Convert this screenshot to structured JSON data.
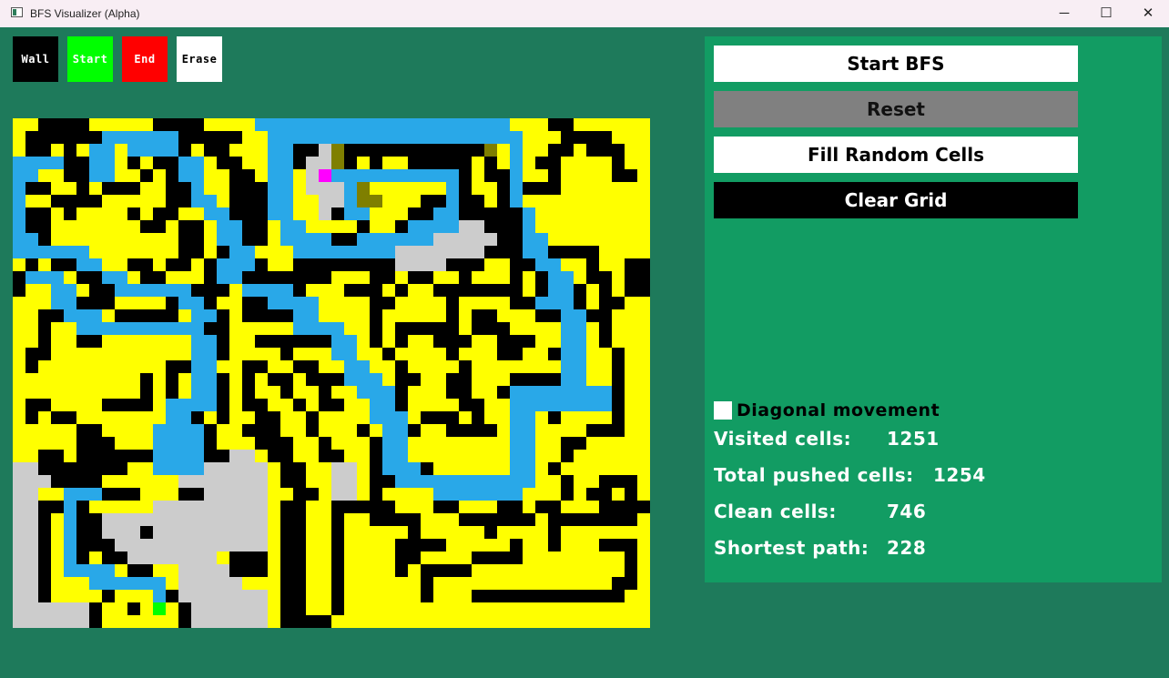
{
  "window": {
    "title": "BFS Visualizer (Alpha)",
    "minimize": "─",
    "maximize": "☐",
    "close": "✕"
  },
  "tools": [
    {
      "label": "Wall",
      "bg": "#000000",
      "fg": "#ffffff"
    },
    {
      "label": "Start",
      "bg": "#00ff00",
      "fg": "#ffffff"
    },
    {
      "label": "End",
      "bg": "#ff0000",
      "fg": "#ffffff"
    },
    {
      "label": "Erase",
      "bg": "#ffffff",
      "fg": "#000000"
    }
  ],
  "buttons": {
    "start_bfs": "Start BFS",
    "reset": "Reset",
    "fill_random": "Fill Random Cells",
    "clear_grid": "Clear Grid"
  },
  "options": {
    "diagonal_label": "Diagonal movement",
    "diagonal_checked": false
  },
  "stats": {
    "visited_label": "Visited cells:",
    "visited_value": "1251",
    "pushed_label": "Total pushed cells:",
    "pushed_value": "1254",
    "clean_label": "Clean cells:",
    "clean_value": "746",
    "path_label": "Shortest path:",
    "path_value": "228"
  },
  "colors": {
    "background": "#1e7a5b",
    "panel": "#129c63",
    "visited": "#ffff00",
    "wall": "#000000",
    "path": "#29a8e8",
    "unvisited": "#cccccc",
    "queued": "#7f7f00",
    "start": "#00ff00",
    "end": "#ff00ff"
  },
  "grid": {
    "cols": 50,
    "rows": 40,
    "legend": "W=wall, Y=visited, B=path, G=unvisited, O=queued, S=start, E=end",
    "cells": [
      "YYWWWWYYYYYWWWWYYYYBBBBBBBBBBBBBBBBBBBBYYYWWYYYYYY",
      "YWWWWWWBBBBBBWWWWWYYBBBBBBBBBBBBBBBBBBBBYYYWWWWYYY",
      "YWWYWYBBYBBBBWYWWYYYBBWWGOWWWWWWWWWWWOYBYYWWYWWWYY",
      "BBBBWWBBYWYWWBBYWWYYBBWGGOWYWYYWWWWWYWYBYWWYYYYWYY",
      "BBYYWWBBYYWYWBBYYWWYBBYGEBBBBBBBBBBWYWWBYYWYYYYWWY",
      "BWWYYWYWWWYYWWBYYWWWBBYGGGBOYYYYYYBWYYWBWWWYYYYYYY",
      "BYYWWWWYYYYYWWBBYWWWBBYYGGBOOYYYWWBWWYWBYYYYYYYYYY",
      "BWWYWYYYYWYWWYYBBWWWBBYYGWBBYYYWWBBWWWWWBYYYYYYYYY",
      "BWWYYYYYYYWWYWWYBBWWYBBYYYYWYYWBBBBGGWWWBYYYYYYYYY",
      "BBWYYYYYYYYYYWWYBBWWYBBBBWWBBBBBBGGGGGWWBBYYYYYYYY",
      "BBBBBBYYYYYYYWWYWBBYYYBBBBBBBBGGGGGGGWWWBBWWWWYYYY",
      "YWYWWBBYYWWYWWYWBBBWYYWWWWWWWWGGGGWWWYYWWBBYYWYYWW",
      "WBBBYWWBBYWWYYYWBBWWWWWWWYYYWWYWWYYWYYYWYWBBYWWYWW",
      "WYYBBYWWBBBBBBWWWYBBBBWYYYWWWYWYYWWWWWWWYWBBWYWYWW",
      "YYYBBWWWYYYYWBBWYYWWBBBBYYYYWWYYYYWYYYYWWBBBWYWWYY",
      "YYWWBBBYWWWWWYBBWYWWWWBBYYYYWYYYYYWYWWYYYWWBBWWYYY",
      "YYWYYBBBBBBBBBBWWYYYYYBBBBYYWYWWWWWYWWWYYYYBBYWYYY",
      "YYWYYWWYYYYYYYBBWYYWWWWWWBBYWYWYYWWWYYWWWYYBBYWYYY",
      "YWWYYYYYYYYYYYBBWYYYYWYYYBBYYWYYYYWYYYWWYYWBBYYWYY",
      "YWYYYYYYYYYYWWBBYYWWYYWWYYBBYYWYYYYWYYYYYYYBBYYWYY",
      "YYYYYYYYYYWYWYBBWYWYWWYWWWBBBYWWYYWWYYYWWWWBBYYWYY",
      "YYYYYYYYYYWYWYBBWYWYYWYYWYYBBBWYYYWWYYWBBBBBBBBWYY",
      "YWWYYYYWWWWYBBBBWYWWYYWYWWYYBBWYYYYWWYYBBBBBBBBWYY",
      "YWYWWYYYYYYYBBWYWYYWWYYWYYYYBBBYWWWYWYYBBYWYYYYWYY",
      "YYYYYWWYYYYBBBBWYYWWWYYWYYYWYBBWYYWWWWYBBYYYYWWWYY",
      "YYYYYWWWYYYBBBBWYYYWWWYYWYYYWBBYYYYYYYYBBYYWWYYYYY",
      "YYWWYWWWWWWBBBBWWGGYWWYYWWYYWBBYYYYYYYYBBYYWYYYYYY",
      "GGWWWWWWWYYBBBBGGGGGYWWYYGGYWBBBWYYYYYYBBYWYYYYYYY",
      "GGGWWWWYYYYYYGGGGGGGYWWYYGGYWWBBBBBBBBBBBYYWYYWWWY",
      "GGYYBBBWWWYYYWWGGGGGYYWWYGGYWYYYYBBBBBBBYYYWYWWYWY",
      "GGWWBWYYYYYGGGGGGGGGYWWYYWWWWWYYYWWYYYWWYWWYYYWWWW",
      "GGWYBWWGGGGGGGGGGGGGYWWYYWYYWWWWYYYWWWWWWYWWWWWWWY",
      "GGWYBWWGGGWGGGGGGGGGYWWYYWYYYYYWYYYYYWYYYYWYYYYYYY",
      "GGWYBWWWGGGGGGGGGGGGYWWYYWYYYYWWWWYYYYYWYYWYYYWWWY",
      "GGWYBWYWWGGGGGGGYWWWYWWYYWYYYYWWYYYYWWWWYYYYYYYYWY",
      "GGWYBBBBYWWYYGGGGWWWYWWYYWYYYYWYWWWWYYYYYYYYYYYYWY",
      "GGWYYYBBBBBBYGGGGGYYYWWYYWYYYYYYWYYYYYYYYYYYYYYWWY",
      "GGWYYYYWYYYBWGGGGGGGYWWYYWYYYYYYWYYYWWWWWWWWWWWWYY",
      "GGGGGGWYYWYSYWGGGGGGYWWYYWYYYYYYYYYYYYYYYYYYYYYYYY",
      "GGGGGGWYYYYYYWGGGGGGYWWWWYYYYYYYYYYYYYYYYYYYYYYYYY"
    ]
  }
}
